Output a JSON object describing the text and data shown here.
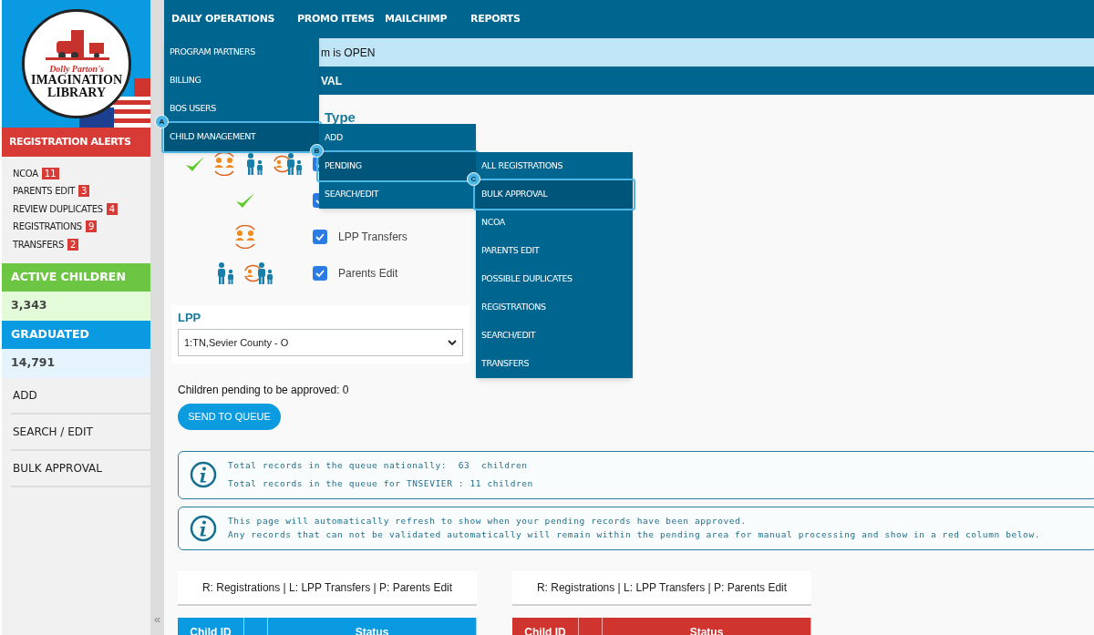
{
  "logo": {
    "script": "Dolly Parton's",
    "title": "IMAGINATION",
    "subtitle": "LIBRARY"
  },
  "sidebar": {
    "alerts_title": "REGISTRATION ALERTS",
    "alerts": [
      {
        "label": "NCOA",
        "count": "11"
      },
      {
        "label": "PARENTS EDIT",
        "count": "3"
      },
      {
        "label": "REVIEW DUPLICATES",
        "count": "4"
      },
      {
        "label": "REGISTRATIONS",
        "count": "9"
      },
      {
        "label": "TRANSFERS",
        "count": "2"
      }
    ],
    "stats": [
      {
        "kind": "active",
        "label": "ACTIVE CHILDREN",
        "value": "3,343"
      },
      {
        "kind": "graduated",
        "label": "GRADUATED",
        "value": "14,791"
      }
    ],
    "links": [
      "ADD",
      "SEARCH / EDIT",
      "BULK APPROVAL"
    ],
    "collapse": "«"
  },
  "nav": [
    "DAILY OPERATIONS",
    "PROMO ITEMS",
    "MAILCHIMP",
    "REPORTS"
  ],
  "banner": "m is OPEN",
  "page_title": "VAL",
  "type_heading": "Type",
  "type_rows": [
    {
      "icons": [
        {
          "kind": "check"
        },
        {
          "kind": "transfer"
        },
        {
          "kind": "family"
        },
        {
          "kind": "familytransfer"
        }
      ],
      "checked": true
    },
    {
      "icons": [
        {
          "kind": "check"
        }
      ],
      "checked": true
    },
    {
      "icons": [
        {
          "kind": "transfer"
        }
      ],
      "checked": true,
      "label": "LPP Transfers"
    },
    {
      "icons": [
        {
          "kind": "family"
        },
        {
          "kind": "familytransfer"
        }
      ],
      "checked": true,
      "label": "Parents Edit"
    }
  ],
  "lpp": {
    "label": "LPP",
    "value": "1:TN,Sevier County - O"
  },
  "pending_text": "Children pending to be approved: 0",
  "send_button": "SEND TO QUEUE",
  "info_boxes": [
    [
      "Total records in the queue nationally:  63  children",
      "Total records in the queue for TNSEVIER : 11 children"
    ],
    [
      "This page will automatically refresh to show when your pending records have been approved.",
      "Any records that can not be validated automatically will remain within the pending area for manual processing and show in a red column below."
    ]
  ],
  "tables": [
    {
      "legend": "R: Registrations | L: LPP Transfers | P: Parents Edit",
      "color": "#0a9ae2",
      "columns": [
        "Child ID",
        "",
        "Status"
      ]
    },
    {
      "legend": "R: Registrations | L: LPP Transfers | P: Parents Edit",
      "color": "#d0342f",
      "columns": [
        "Child ID",
        "",
        "Status"
      ]
    }
  ],
  "menus": [
    {
      "items": [
        {
          "label": "PROGRAM PARTNERS",
          "selected": false
        },
        {
          "label": "BILLING",
          "selected": false
        },
        {
          "label": "BOS USERS",
          "selected": false
        },
        {
          "label": "CHILD MANAGEMENT",
          "selected": true,
          "callout": "A"
        }
      ]
    },
    {
      "items": [
        {
          "label": "ADD",
          "selected": false
        },
        {
          "label": "PENDING",
          "selected": true,
          "callout": "B"
        },
        {
          "label": "SEARCH/EDIT",
          "selected": false
        }
      ]
    },
    {
      "items": [
        {
          "label": "ALL REGISTRATIONS",
          "selected": false
        },
        {
          "label": "BULK APPROVAL",
          "selected": true,
          "callout": "C"
        },
        {
          "label": "NCOA",
          "selected": false
        },
        {
          "label": "PARENTS EDIT",
          "selected": false
        },
        {
          "label": "POSSIBLE DUPLICATES",
          "selected": false
        },
        {
          "label": "REGISTRATIONS",
          "selected": false
        },
        {
          "label": "SEARCH/EDIT",
          "selected": false
        },
        {
          "label": "TRANSFERS",
          "selected": false
        }
      ]
    }
  ]
}
